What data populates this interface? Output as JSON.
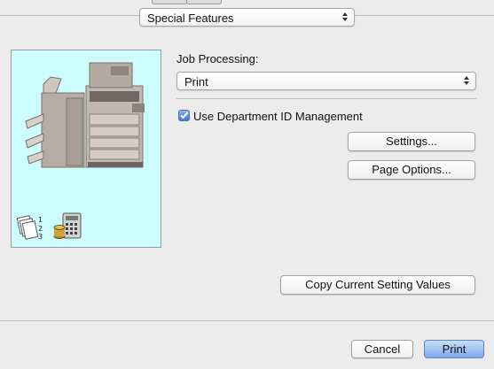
{
  "window": {
    "panel_select": "Special Features"
  },
  "job_processing": {
    "label": "Job Processing:",
    "value": "Print"
  },
  "department_id": {
    "label": "Use Department ID Management",
    "checked": true
  },
  "buttons": {
    "settings": "Settings...",
    "page_options": "Page Options...",
    "copy_values": "Copy Current Setting Values",
    "cancel": "Cancel",
    "print": "Print"
  },
  "preview": {
    "printer_icon": "printer-illustration-icon",
    "collate_icon": "collated-pages-icon",
    "accounting_icon": "calculator-department-icon"
  },
  "colors": {
    "preview_bg": "#ccfeff",
    "accent": "#7fa9ea"
  }
}
